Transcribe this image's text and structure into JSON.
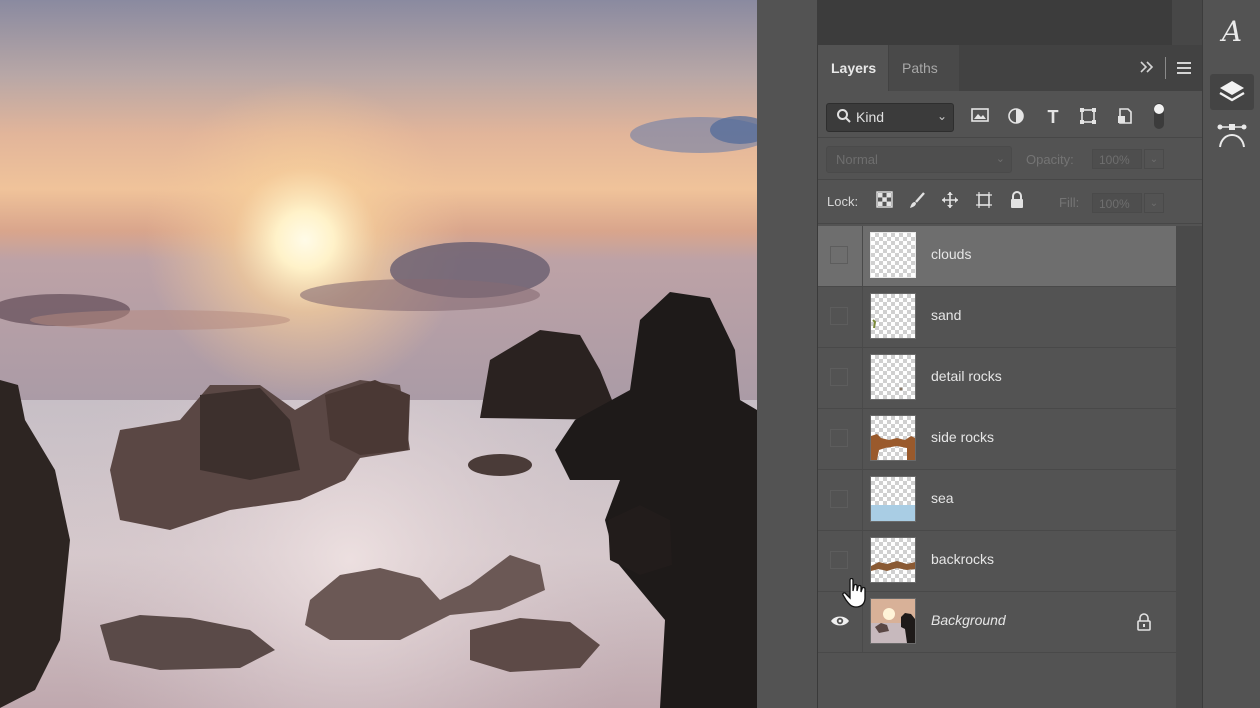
{
  "panel": {
    "tabs": [
      "Layers",
      "Paths"
    ],
    "collapse_icon": "double-chevron-right-icon",
    "menu_icon": "hamburger-menu-icon",
    "filter": {
      "kind_label": "Kind",
      "icons": [
        "image-filter-icon",
        "adjustment-filter-icon",
        "type-filter-icon",
        "shape-filter-icon",
        "smart-object-filter-icon",
        "filter-toggle-icon"
      ]
    },
    "blend_mode": "Normal",
    "opacity_label": "Opacity:",
    "opacity_value": "100%",
    "lock_label": "Lock:",
    "lock_icons": [
      "lock-transparent-pixels-icon",
      "lock-image-pixels-icon",
      "lock-position-icon",
      "lock-artboard-icon",
      "lock-all-icon"
    ],
    "fill_label": "Fill:",
    "fill_value": "100%",
    "layers": [
      {
        "name": "clouds",
        "visible": false,
        "selected": true
      },
      {
        "name": "sand",
        "visible": false,
        "selected": false
      },
      {
        "name": "detail rocks",
        "visible": false,
        "selected": false
      },
      {
        "name": "side rocks",
        "visible": false,
        "selected": false
      },
      {
        "name": "sea",
        "visible": false,
        "selected": false
      },
      {
        "name": "backrocks",
        "visible": false,
        "selected": false
      },
      {
        "name": "Background",
        "visible": true,
        "selected": false,
        "locked": true
      }
    ]
  },
  "right_strip": {
    "icons": [
      "character-panel-icon",
      "layers-panel-icon",
      "paths-panel-icon"
    ]
  },
  "colors": {
    "panel_bg": "#535353",
    "selected_row": "#6e6e6e",
    "tab_bar": "#424242"
  }
}
